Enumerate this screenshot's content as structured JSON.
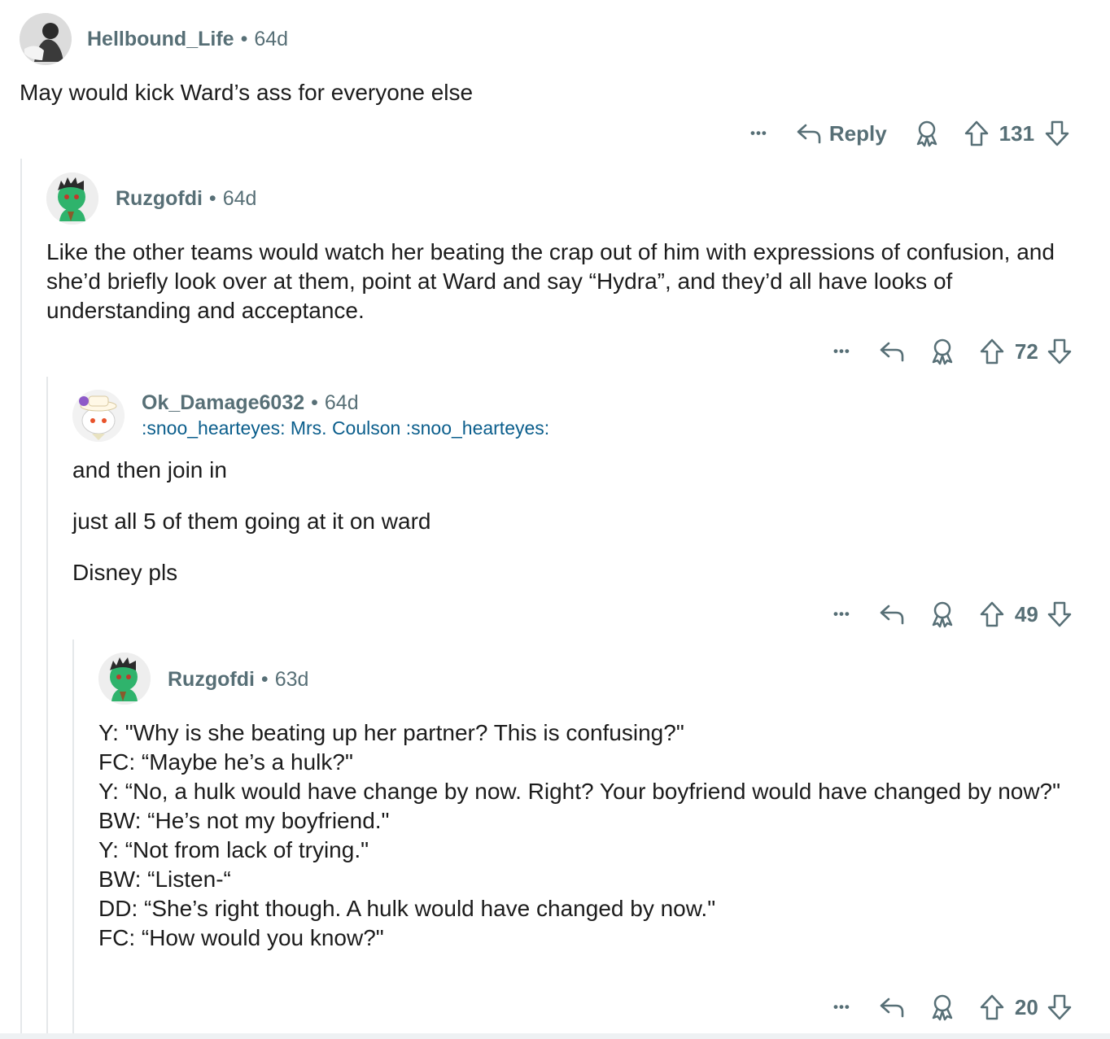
{
  "comments": [
    {
      "username": "Hellbound_Life",
      "separator": "•",
      "age": "64d",
      "body": [
        "May would kick Ward’s ass for everyone else"
      ],
      "actions": {
        "more": "•••",
        "reply_label": "Reply",
        "score": "131"
      }
    },
    {
      "username": "Ruzgofdi",
      "separator": "•",
      "age": "64d",
      "body": [
        "Like the other teams would watch her beating the crap out of him with expressions of confusion, and she’d briefly look over at them, point at Ward and say “Hydra”, and they’d all have looks of understanding and acceptance."
      ],
      "actions": {
        "more": "•••",
        "score": "72"
      }
    },
    {
      "username": "Ok_Damage6032",
      "separator": "•",
      "age": "64d",
      "flair": ":snoo_hearteyes: Mrs. Coulson :snoo_hearteyes:",
      "body": [
        "and then join in",
        "just all 5 of them going at it on ward",
        "Disney pls"
      ],
      "actions": {
        "more": "•••",
        "score": "49"
      }
    },
    {
      "username": "Ruzgofdi",
      "separator": "•",
      "age": "63d",
      "body": [
        "Y: \"Why is she beating up her partner?  This is confusing?\"",
        "FC: “Maybe he’s a hulk?\"",
        "Y: “No, a hulk would have change by now.  Right?  Your boyfriend would have changed by now?\"",
        "BW: “He’s not my boyfriend.\"",
        "Y: “Not from lack of trying.\"",
        "BW: “Listen-“",
        "DD: “She’s right though.  A hulk would have changed by now.\"",
        "FC: “How would you know?\""
      ],
      "actions": {
        "more": "•••",
        "score": "20"
      }
    }
  ],
  "colors": {
    "meta": "#576f76",
    "text": "#1c1c1c",
    "flair": "#0b5e8c",
    "thread_line": "#e5e8ea",
    "avatar_green": "#2fb36c"
  },
  "icons": [
    "reply-icon",
    "award-icon",
    "upvote-icon",
    "downvote-icon",
    "more-icon"
  ]
}
